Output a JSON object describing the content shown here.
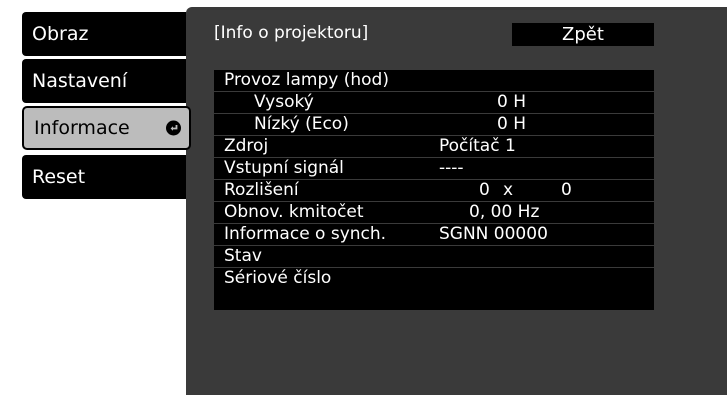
{
  "menu": {
    "items": [
      {
        "label": "Obraz"
      },
      {
        "label": "Nastavení"
      },
      {
        "label": "Informace"
      },
      {
        "label": "Reset"
      }
    ],
    "selected_index": 2
  },
  "header": {
    "title": "[Info o projektoru]",
    "back_label": "Zpět"
  },
  "info": {
    "lamp_hours_label": "Provoz lampy (hod)",
    "high_label": "Vysoký",
    "high_value": "0 H",
    "eco_label": "Nízký (Eco)",
    "eco_value": "0 H",
    "source_label": "Zdroj",
    "source_value": "Počítač 1",
    "input_signal_label": "Vstupní signál",
    "input_signal_value": "----",
    "resolution_label": "Rozlišení",
    "resolution_w": "0",
    "resolution_x": "x",
    "resolution_h": "0",
    "refresh_label": "Obnov. kmitočet",
    "refresh_value": "0, 00 Hz",
    "sync_label": "Informace o synch.",
    "sync_value": "SGNN 00000",
    "status_label": "Stav",
    "serial_label": "Sériové číslo"
  },
  "colors": {
    "panel_bg": "#3a3a3a",
    "menu_bg": "#000000",
    "selected_bg": "#bcbcbc",
    "text": "#ffffff"
  }
}
